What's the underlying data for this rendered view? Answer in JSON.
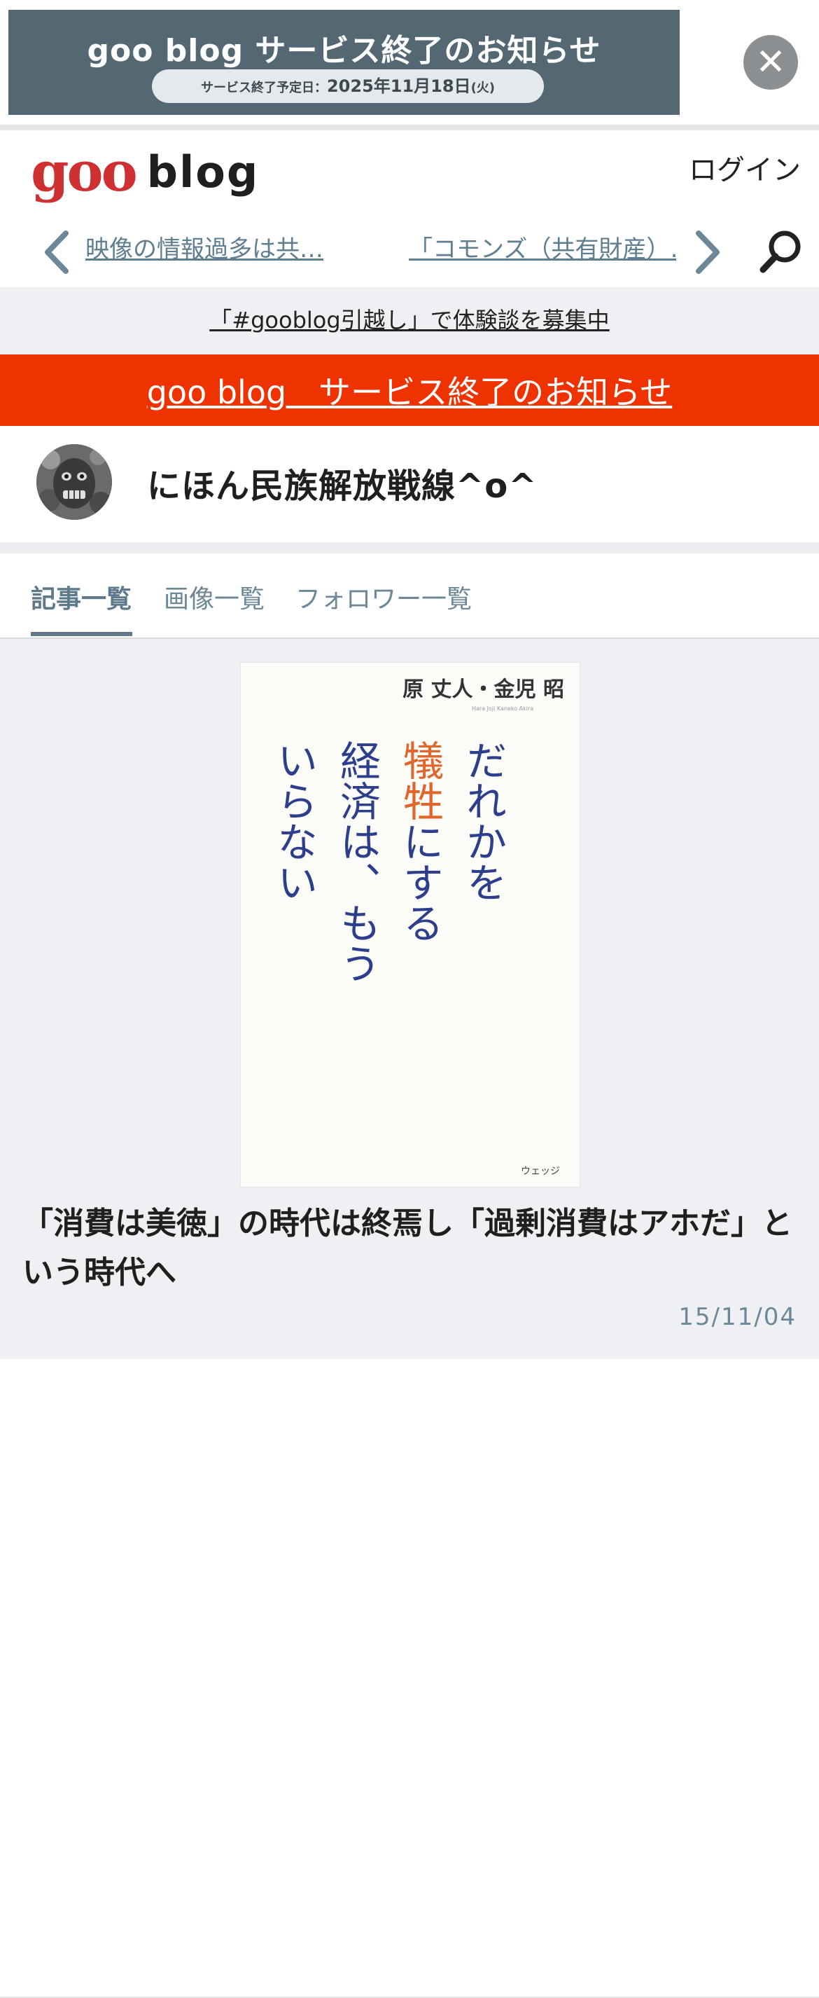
{
  "ad_banner": {
    "title": "goo blog サービス終了のお知らせ",
    "pill_prefix": "サービス終了予定日：",
    "pill_date": "2025年11月18日",
    "pill_day": "(火)",
    "bg_color": "#546873"
  },
  "header": {
    "logo_goo": "goo",
    "logo_blog": "blog",
    "login_label": "ログイン",
    "logo_color": "#cf3133"
  },
  "nav": {
    "prev_title": "映像の情報過多は共…",
    "next_title": "「コモンズ（共有財産）…"
  },
  "info_link": "「#gooblog引越し」で体験談を募集中",
  "notice": {
    "label": "goo blog　サービス終了のお知らせ",
    "bg_color": "#ee3300"
  },
  "blog": {
    "name": "にほん民族解放戦線^o^"
  },
  "tabs": [
    {
      "label": "記事一覧",
      "active": true
    },
    {
      "label": "画像一覧",
      "active": false
    },
    {
      "label": "フォロワー一覧",
      "active": false
    }
  ],
  "post": {
    "cover": {
      "authors": "原 丈人・金児 昭",
      "author_roman": "Hara Joji   Kaneko Akira",
      "title_lines": [
        "だれかを",
        "犠牲にする",
        "経済は、もう",
        "いらない"
      ],
      "publisher": "ウェッジ"
    },
    "title": "「消費は美徳」の時代は終焉し「過剰消費はアホだ」という時代へ",
    "date": "15/11/04"
  }
}
